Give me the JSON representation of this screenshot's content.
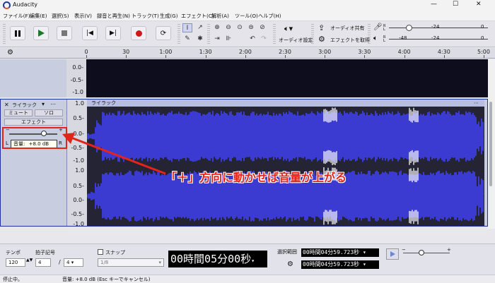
{
  "app": {
    "title": "Audacity",
    "title_icon": "audacity-headphones-icon"
  },
  "window_controls": {
    "minimize": "—",
    "maximize": "☐",
    "close": "✕"
  },
  "menu": [
    "ファイル(F)",
    "編集(E)",
    "選択(S)",
    "表示(V)",
    "録音と再生(N)",
    "トラック(T)",
    "生成(G)",
    "エフェクト(C)",
    "解析(A)",
    "ツール(O)",
    "ヘルプ(H)"
  ],
  "toolbar": {
    "audio_settings_label": "オーディオ設定",
    "share_audio_label": "オーディオ共有",
    "get_effects_label": "エフェクトを取得",
    "record_meter_labels": [
      "-24",
      "0"
    ],
    "play_meter_labels": [
      "-48",
      "-24",
      "0"
    ],
    "record_meter_channels": "R L",
    "play_meter_channels": "R L"
  },
  "timeline": {
    "ticks": [
      "0",
      "30",
      "1:00",
      "1:30",
      "2:00",
      "2:30",
      "3:00",
      "3:30",
      "4:00",
      "4:30",
      "5:00"
    ]
  },
  "scale_labels": [
    "0.0-",
    "-0.5-",
    "-1.0"
  ],
  "scale_labels_full": [
    "1.0",
    "0.5-",
    "0.0-",
    "-0.5-",
    "-1.0",
    "1.0",
    "0.5-",
    "0.0-",
    "-0.5-",
    "-1.0"
  ],
  "track": {
    "name": "ライラック",
    "clip_name": "ライラック",
    "mute_label": "ミュート",
    "solo_label": "ソロ",
    "effects_label": "エフェクト",
    "gain_minus": "−",
    "gain_plus": "+",
    "pan_left": "L",
    "pan_right": "R",
    "gain_tooltip": "音量: +8.0 dB",
    "gain_tooltip_label": "音量:",
    "gain_tooltip_value": "+8.0 dB",
    "gain_position": 0.75,
    "close_glyph": "✕",
    "menu_glyph": "▾",
    "collapse_glyph": "⋯"
  },
  "annotation": {
    "text": "「＋」方向に動かせば音量が上がる",
    "color": "#e1251b"
  },
  "bottom": {
    "tempo_label": "テンポ",
    "tempo_value": "120",
    "time_sig_label": "拍子記号",
    "time_sig_num": "4",
    "time_sig_den": "4",
    "time_sig_sep": "/",
    "snap_label": "スナップ",
    "snap_value": "1/8",
    "time_display": "00時間05分00秒",
    "selection_label": "選択範囲",
    "selection_start": "00時間04分59.723秒",
    "selection_end": "00時間04分59.723秒",
    "play_speed_minus": "−",
    "play_speed_plus": "+"
  },
  "status": {
    "state": "停止中。",
    "message": "音量: +8.0 dB (Esc キーでキャンセル)"
  },
  "colors": {
    "waveform": "#3b3bd2",
    "waveform_peak": "#ffffff",
    "track_bg": "#242434",
    "accent": "#2030a0"
  }
}
